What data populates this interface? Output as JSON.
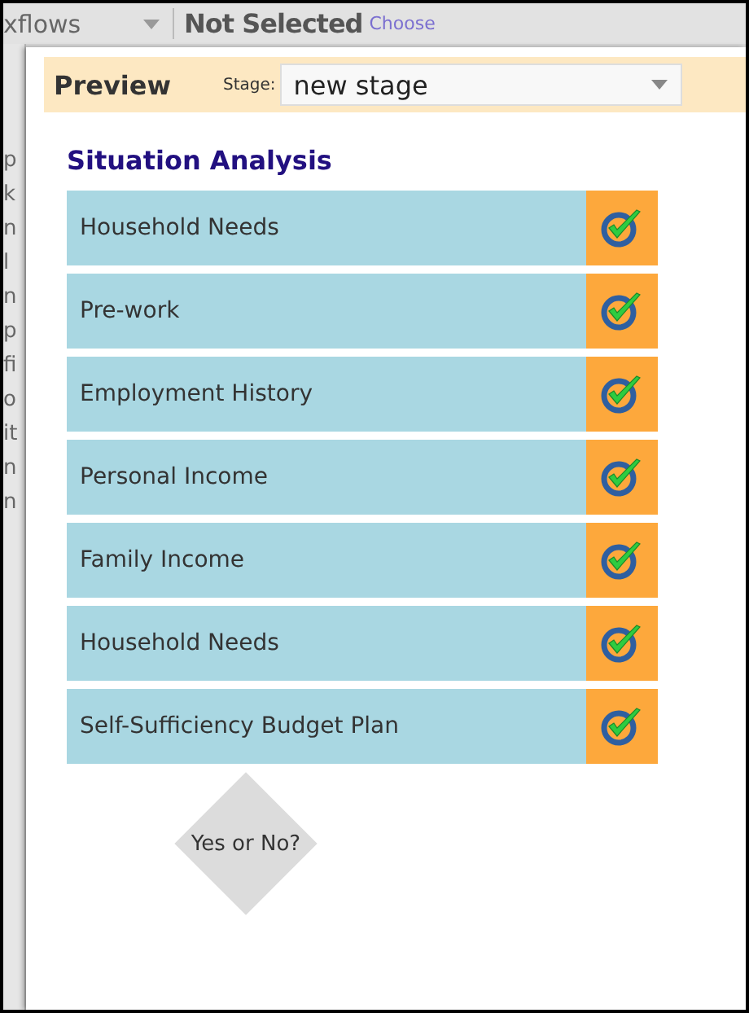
{
  "background": {
    "menu_label": "xflows",
    "status": "Not Selected",
    "choose_link": "Choose",
    "fragments": [
      "p",
      "k",
      "n",
      "l",
      "n",
      "p",
      "fi",
      "o",
      "it",
      "n",
      "n"
    ]
  },
  "preview": {
    "title": "Preview",
    "stage_label": "Stage:",
    "stage_value": "new stage"
  },
  "section": {
    "title": "Situation Analysis",
    "steps": [
      {
        "label": "Household Needs",
        "complete": true
      },
      {
        "label": "Pre-work",
        "complete": true
      },
      {
        "label": "Employment History",
        "complete": true
      },
      {
        "label": "Personal Income",
        "complete": true
      },
      {
        "label": "Family Income",
        "complete": true
      },
      {
        "label": "Household Needs",
        "complete": true
      },
      {
        "label": "Self-Sufficiency Budget Plan",
        "complete": true
      }
    ]
  },
  "decision": {
    "label": "Yes or No?"
  }
}
